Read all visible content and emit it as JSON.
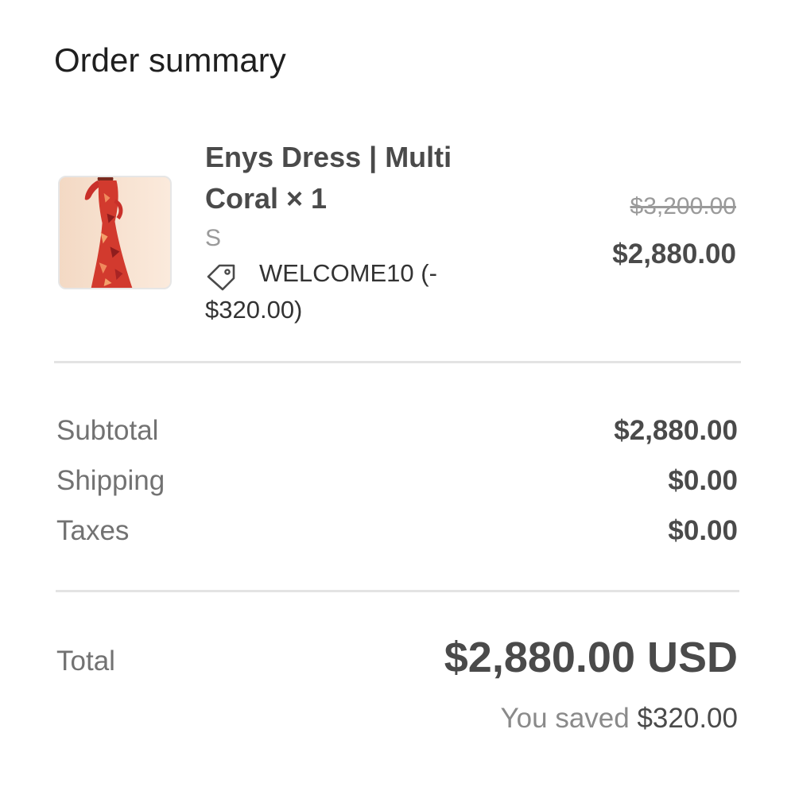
{
  "header": {
    "title": "Order summary"
  },
  "product": {
    "image_alt": "Enys Dress | Multi Coral",
    "name_line1": "Enys Dress | Multi",
    "name_line2": "Coral × 1",
    "variant": "S",
    "discount_icon": "tag-icon",
    "discount_line1": "WELCOME10 (-",
    "discount_line2": "$320.00)",
    "price_original": "$3,200.00",
    "price_current": "$2,880.00"
  },
  "summary": {
    "rows": [
      {
        "label": "Subtotal",
        "value": "$2,880.00"
      },
      {
        "label": "Shipping",
        "value": "$0.00"
      },
      {
        "label": "Taxes",
        "value": "$0.00"
      }
    ]
  },
  "total": {
    "label": "Total",
    "value": "$2,880.00 USD",
    "saved_label": "You saved",
    "saved_amount": "$320.00"
  },
  "colors": {
    "text_primary": "#4a4a4a",
    "text_secondary": "#727272",
    "divider": "#e3e3e3",
    "dress_red": "#d23a2e",
    "thumb_bg": "#f7e0cf"
  }
}
